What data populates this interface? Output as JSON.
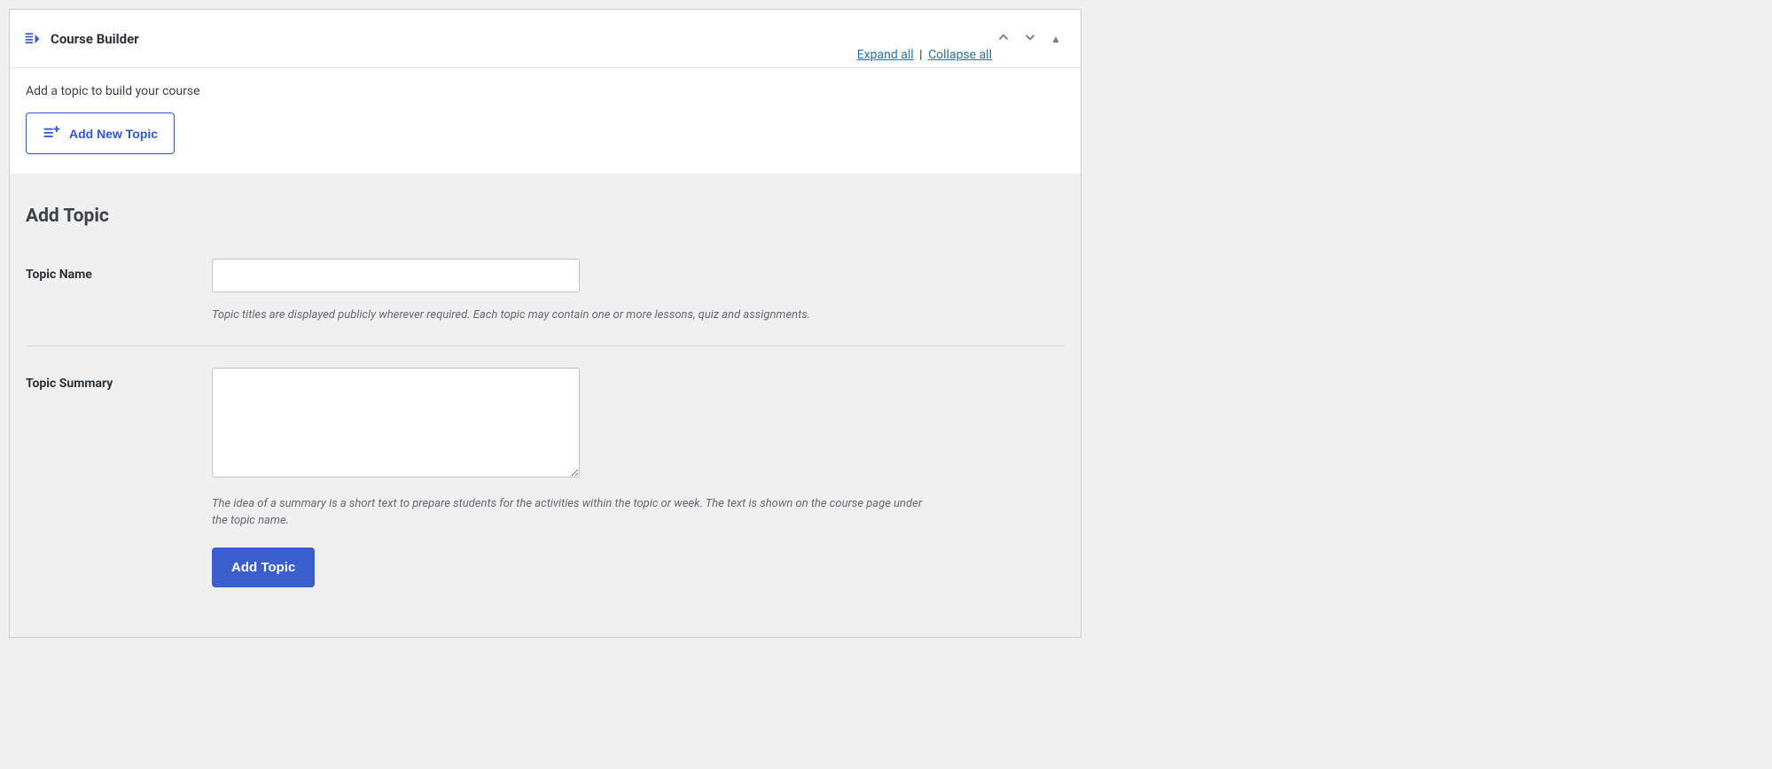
{
  "panel": {
    "title": "Course Builder",
    "expand_all": "Expand all",
    "collapse_all": "Collapse all",
    "separator": " | "
  },
  "top_section": {
    "instruction": "Add a topic to build your course",
    "add_button_label": "Add New Topic"
  },
  "add_topic": {
    "heading": "Add Topic",
    "topic_name": {
      "label": "Topic Name",
      "value": "",
      "help": "Topic titles are displayed publicly wherever required. Each topic may contain one or more lessons, quiz and assignments."
    },
    "topic_summary": {
      "label": "Topic Summary",
      "value": "",
      "help": "The idea of a summary is a short text to prepare students for the activities within the topic or week. The text is shown on the course page under the topic name."
    },
    "submit_label": "Add Topic"
  }
}
